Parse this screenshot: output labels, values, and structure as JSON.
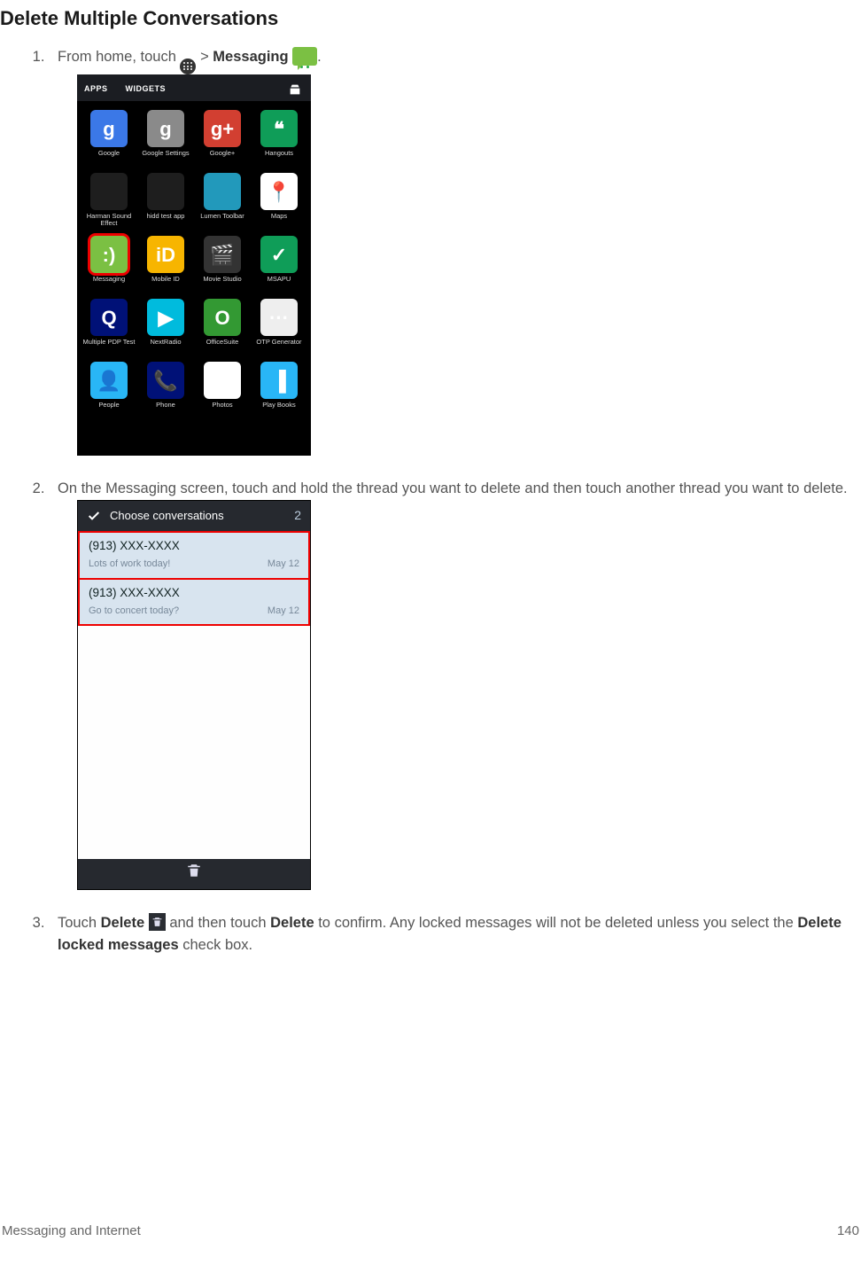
{
  "heading": "Delete Multiple Conversations",
  "steps": {
    "s1a": "From home, touch ",
    "s1b": " > ",
    "s1c": "Messaging",
    "s1d": " ",
    "s1e": ".",
    "s2": "On the Messaging screen, touch and hold the thread you want to delete and then touch another thread you want to delete.",
    "s3a": "Touch ",
    "s3b": "Delete",
    "s3c": " ",
    "s3d": " and then touch ",
    "s3e": "Delete",
    "s3f": " to confirm. Any locked messages will not be deleted unless you select the ",
    "s3g": "Delete locked messages",
    "s3h": " check box."
  },
  "shot1": {
    "tabs": {
      "apps": "APPS",
      "widgets": "WIDGETS"
    },
    "apps": [
      {
        "label": "Google",
        "bg": "#3b78e7",
        "txt": "g"
      },
      {
        "label": "Google Settings",
        "bg": "#8a8a8a",
        "txt": "g"
      },
      {
        "label": "Google+",
        "bg": "#d23f31",
        "txt": "g+"
      },
      {
        "label": "Hangouts",
        "bg": "#0f9d58",
        "txt": "❝"
      },
      {
        "label": "Harman Sound Effect",
        "bg": "#1e1e1e",
        "txt": ""
      },
      {
        "label": "hidd test app",
        "bg": "#1e1e1e",
        "txt": ""
      },
      {
        "label": "Lumen Toolbar",
        "bg": "#29b",
        "txt": ""
      },
      {
        "label": "Maps",
        "bg": "#fff",
        "txt": "📍"
      },
      {
        "label": "Messaging",
        "bg": "#7bc043",
        "txt": ":)",
        "hl": true
      },
      {
        "label": "Mobile ID",
        "bg": "#f7b500",
        "txt": "iD"
      },
      {
        "label": "Movie Studio",
        "bg": "#333",
        "txt": "🎬"
      },
      {
        "label": "MSAPU",
        "bg": "#0f9d58",
        "txt": "✓"
      },
      {
        "label": "Multiple PDP Test",
        "bg": "#017",
        "txt": "Q"
      },
      {
        "label": "NextRadio",
        "bg": "#0bd",
        "txt": "▶"
      },
      {
        "label": "OfficeSuite",
        "bg": "#393",
        "txt": "O"
      },
      {
        "label": "OTP Generator",
        "bg": "#eee",
        "txt": "···"
      },
      {
        "label": "People",
        "bg": "#29b6f6",
        "txt": "👤"
      },
      {
        "label": "Phone",
        "bg": "#017",
        "txt": "📞"
      },
      {
        "label": "Photos",
        "bg": "#fff",
        "txt": "✿"
      },
      {
        "label": "Play Books",
        "bg": "#29b6f6",
        "txt": "▐"
      }
    ]
  },
  "shot2": {
    "header": "Choose conversations",
    "count": "2",
    "threads": [
      {
        "title": "(913) XXX-XXXX",
        "preview": "Lots of work today!",
        "date": "May 12"
      },
      {
        "title": "(913) XXX-XXXX",
        "preview": "Go to concert today?",
        "date": "May 12"
      }
    ]
  },
  "footer": {
    "section": "Messaging and Internet",
    "page": "140"
  }
}
